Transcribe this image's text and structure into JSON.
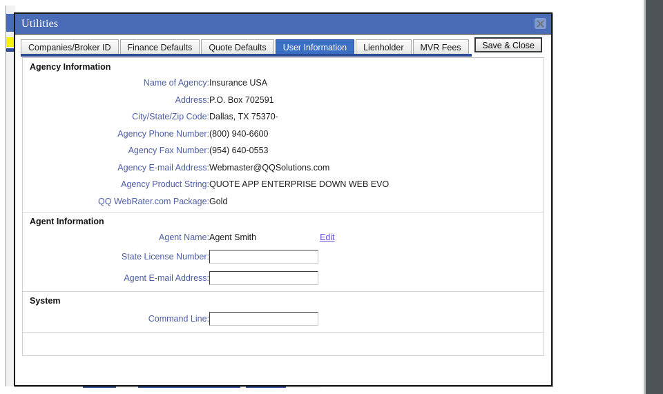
{
  "window": {
    "title": "Utilities",
    "close_icon": "close-x-icon"
  },
  "tabs": [
    {
      "label": "Companies/Broker ID",
      "active": false
    },
    {
      "label": "Finance Defaults",
      "active": false
    },
    {
      "label": "Quote Defaults",
      "active": false
    },
    {
      "label": "User Information",
      "active": true
    },
    {
      "label": "Lienholder",
      "active": false
    },
    {
      "label": "MVR Fees",
      "active": false
    }
  ],
  "toolbar": {
    "save_close_label": "Save & Close"
  },
  "sections": {
    "agency": {
      "title": "Agency Information",
      "rows": [
        {
          "label": "Name of Agency:",
          "value": "Insurance USA"
        },
        {
          "label": "Address:",
          "value": "P.O. Box 702591"
        },
        {
          "label": "City/State/Zip Code:",
          "value": "Dallas, TX 75370-"
        },
        {
          "label": "Agency Phone Number:",
          "value": "(800) 940-6600"
        },
        {
          "label": "Agency Fax Number:",
          "value": "(954) 640-0553"
        },
        {
          "label": "Agency E-mail Address:",
          "value": "Webmaster@QQSolutions.com"
        },
        {
          "label": "Agency Product String:",
          "value": "QUOTE APP ENTERPRISE DOWN WEB EVO"
        },
        {
          "label": "QQ WebRater.com Package:",
          "value": "Gold"
        }
      ]
    },
    "agent": {
      "title": "Agent Information",
      "name_label": "Agent Name:",
      "name_value": "Agent Smith",
      "edit_link": "Edit",
      "license_label": "State License Number:",
      "license_value": "",
      "license_placeholder": "",
      "email_label": "Agent E-mail Address:",
      "email_value": "",
      "email_placeholder": ""
    },
    "system": {
      "title": "System",
      "command_label": "Command Line:",
      "command_value": "",
      "command_placeholder": ""
    }
  },
  "colors": {
    "titlebar": "#4a6bb5",
    "active_tab": "#3b6fc4",
    "tab_underline": "#2c4a96",
    "label_text": "#4e5ea6",
    "link": "#6a4fd8",
    "right_gutter": "#4e5357"
  }
}
